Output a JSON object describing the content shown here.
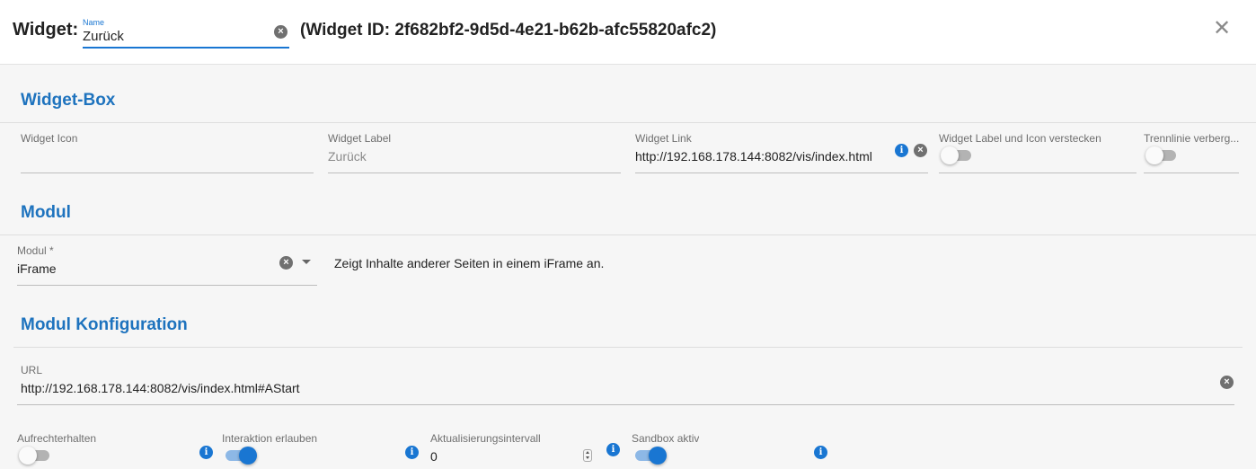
{
  "header": {
    "widget_label": "Widget:",
    "name_caption": "Name",
    "name_value": "Zurück",
    "widget_id_text": "(Widget ID: 2f682bf2-9d5d-4e21-b62b-afc55820afc2)",
    "close_icon": "close-icon"
  },
  "widget_box": {
    "title": "Widget-Box",
    "icon_caption": "Widget Icon",
    "icon_value": "",
    "label_caption": "Widget Label",
    "label_placeholder": "Zurück",
    "link_caption": "Widget Link",
    "link_value": "http://192.168.178.144:8082/vis/index.html",
    "hide_caption": "Widget Label und Icon verstecken",
    "hide_on": false,
    "divider_caption": "Trennlinie verberg...",
    "divider_on": false
  },
  "modul": {
    "title": "Modul",
    "caption": "Modul *",
    "value": "iFrame",
    "description": "Zeigt Inhalte anderer Seiten in einem iFrame an."
  },
  "modul_config": {
    "title": "Modul Konfiguration",
    "url_caption": "URL",
    "url_value": "http://192.168.178.144:8082/vis/index.html#AStart",
    "keep_caption": "Aufrechterhalten",
    "keep_on": false,
    "interaction_caption": "Interaktion erlauben",
    "interaction_on": true,
    "interval_caption": "Aktualisierungsintervall",
    "interval_value": "0",
    "sandbox_caption": "Sandbox aktiv",
    "sandbox_on": true
  },
  "colors": {
    "accent": "#1976d2",
    "section_title": "#1e73be"
  }
}
